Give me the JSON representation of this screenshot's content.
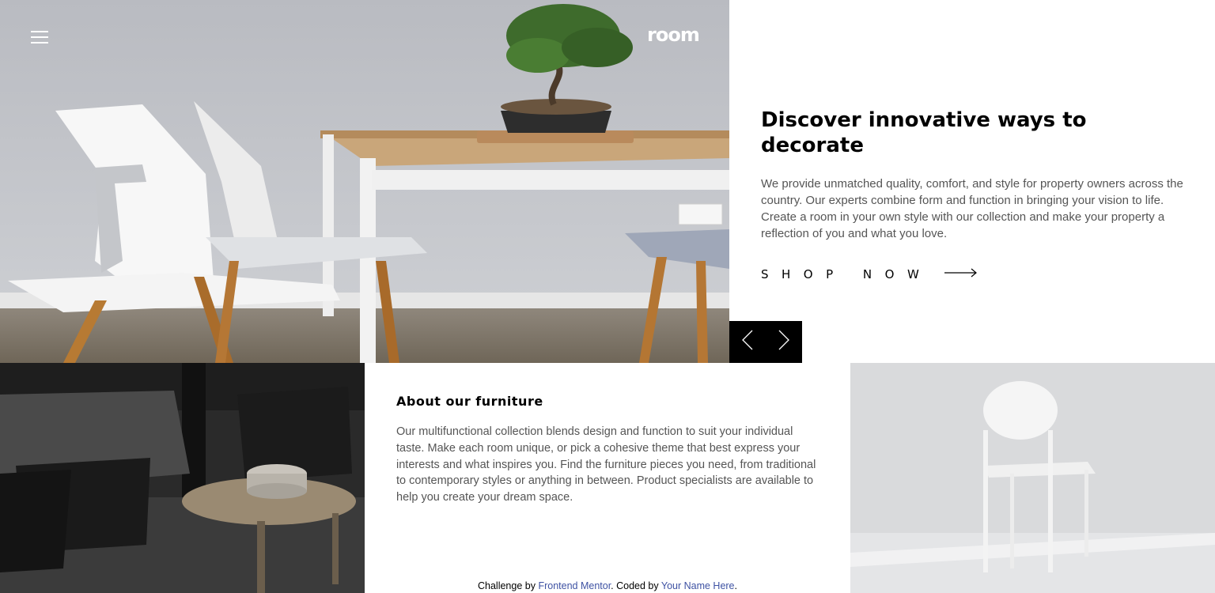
{
  "header": {
    "logo_text": "room",
    "menu_icon": "hamburger-menu-icon"
  },
  "hero": {
    "title": "Discover innovative ways to decorate",
    "description": "We provide unmatched quality, comfort, and style for property owners across the country. Our experts combine form and function in bringing your vision to life. Create a room in your own style with our collection and make your property a reflection of you and what you love.",
    "cta_label": "SHOP NOW",
    "cta_icon": "arrow-right-icon"
  },
  "slider": {
    "prev_icon": "chevron-left-icon",
    "next_icon": "chevron-right-icon"
  },
  "about": {
    "title": "About our furniture",
    "description": "Our multifunctional collection blends design and function to suit your individual taste. Make each room unique, or pick a cohesive theme that best express your interests and what inspires you. Find the furniture pieces you need, from traditional to contemporary styles or anything in between. Product specialists are available to help you create your dream space."
  },
  "attribution": {
    "prefix": "Challenge by ",
    "link1": "Frontend Mentor",
    "middle": ". Coded by ",
    "link2": "Your Name Here",
    "suffix": "."
  },
  "colors": {
    "text_dark": "#000000",
    "text_body": "#555555",
    "link": "#3e52a3",
    "control_bg": "#000000"
  }
}
